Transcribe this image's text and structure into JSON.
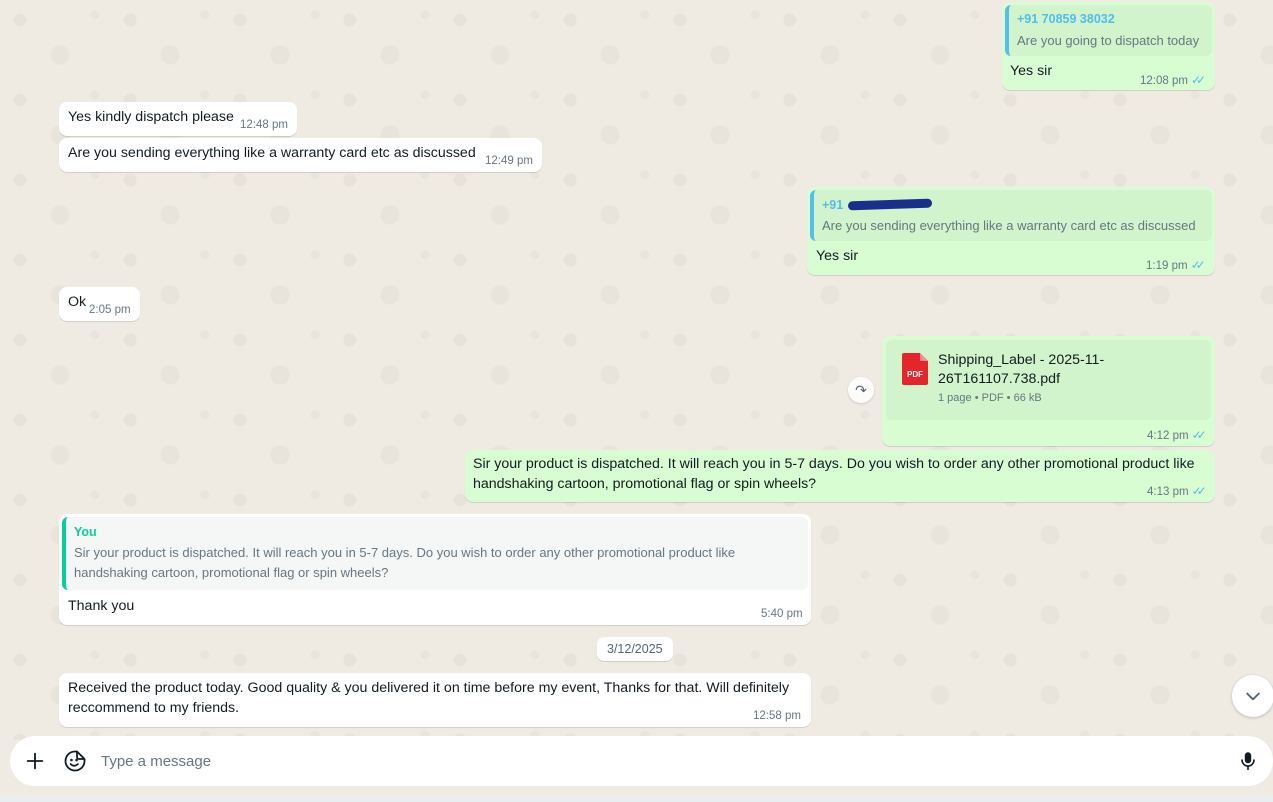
{
  "messages": [
    {
      "quote_author": "+91 70859 38032",
      "quote_text": "Are you going to dispatch today",
      "text": "Yes sir",
      "time": "12:08 pm"
    },
    {
      "text": "Yes kindly dispatch please",
      "time": "12:48 pm"
    },
    {
      "text": "Are you sending everything like a warranty card  etc as discussed",
      "time": "12:49 pm"
    },
    {
      "quote_author": "+91",
      "quote_text": "Are you sending everything like a warranty card  etc as discussed",
      "text": "Yes sir",
      "time": "1:19 pm"
    },
    {
      "text": "Ok",
      "time": "2:05 pm"
    },
    {
      "file_icon_label": "PDF",
      "file_name_line1": "Shipping_Label - 2025-11-",
      "file_name_line2": "26T161107.738.pdf",
      "file_meta": "1 page • PDF • 66 kB",
      "time": "4:12 pm"
    },
    {
      "line1": "Sir your product is dispatched. It will reach you in 5-7 days. Do you wish to order any other promotional product like",
      "line2": "handshaking cartoon, promotional flag or spin wheels?",
      "time": "4:13 pm"
    },
    {
      "quote_author": "You",
      "quote_line1": "Sir your product is dispatched. It will reach you in 5-7 days. Do you wish to order any other promotional product like",
      "quote_line2": "handshaking cartoon, promotional flag or spin wheels?",
      "text": "Thank you",
      "time": "5:40 pm"
    },
    {
      "line1": "Received the product today. Good quality & you delivered it on time before my event, Thanks for that. Will definitely",
      "line2": "reccommend to my friends.",
      "time": "12:58 pm"
    }
  ],
  "date_separator": "3/12/2025",
  "composer": {
    "placeholder": "Type a message"
  },
  "icons": {
    "read_ticks": "double-check-icon",
    "forward": "forward-icon",
    "scroll_down": "chevron-down-icon",
    "attach": "plus-icon",
    "sticker": "sticker-icon",
    "mic": "microphone-icon",
    "pdf": "pdf-file-icon"
  },
  "colors": {
    "incoming": "#ffffff",
    "outgoing": "#d9fdd3",
    "tick": "#53bdeb",
    "quote_you": "#06cf9c",
    "quote_other": "#53bdeb",
    "pdf_red": "#e5252a"
  }
}
